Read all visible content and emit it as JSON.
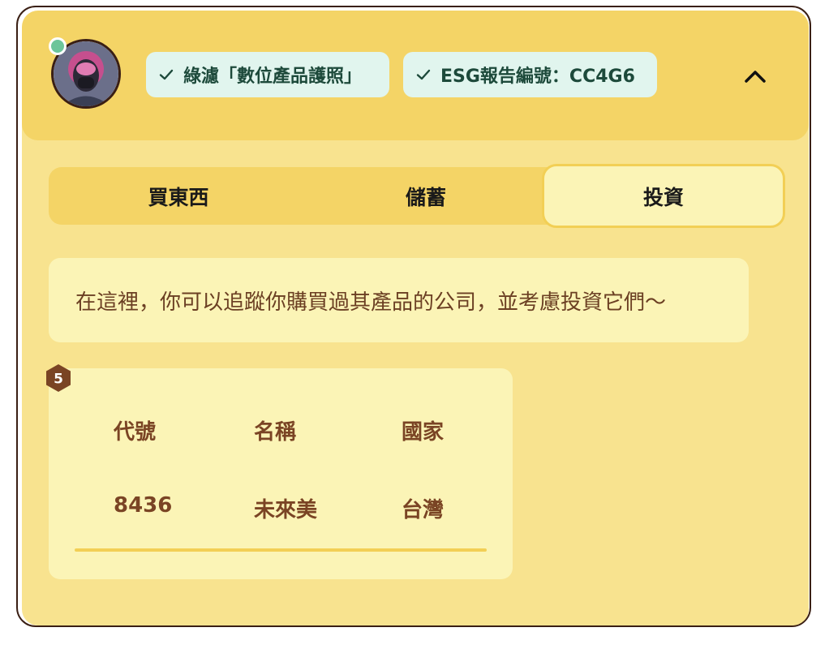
{
  "header": {
    "avatar_alt": "avatar",
    "chips": [
      {
        "label": "綠濾「數位產品護照」"
      },
      {
        "label": "ESG報告編號：CC4G6"
      }
    ]
  },
  "tabs": [
    {
      "label": "買東西"
    },
    {
      "label": "儲蓄"
    },
    {
      "label": "投資"
    }
  ],
  "active_tab": "投資",
  "info_text": "在這裡，你可以追蹤你購買過其產品的公司，並考慮投資它們～",
  "badge_value": "5",
  "table": {
    "headers": [
      "代號",
      "名稱",
      "國家"
    ],
    "rows": [
      [
        "8436",
        "未來美",
        "台灣"
      ]
    ]
  },
  "colors": {
    "card_bg": "#f8e38f",
    "header_bg": "#f4d466",
    "chip_bg": "#e1f5ee",
    "text_brown": "#7a4424",
    "status_dot": "#6cc59a"
  }
}
